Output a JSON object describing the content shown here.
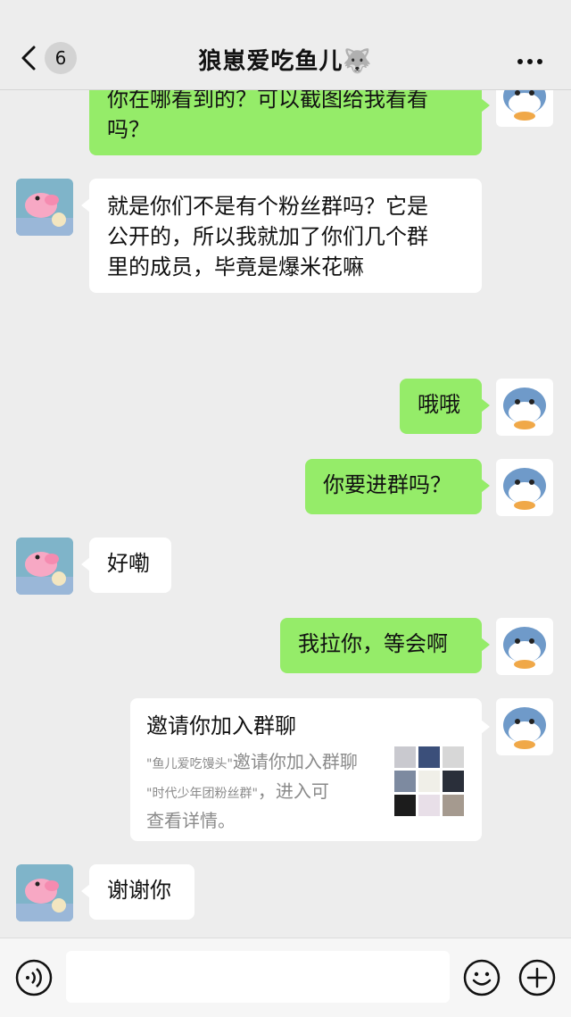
{
  "header": {
    "back_badge": "6",
    "title": "狼崽爱吃鱼儿🐺"
  },
  "messages": [
    {
      "side": "out",
      "text": "你在哪看到的？可以截图给我看看吗？",
      "lines": [
        "你在哪看到的？可以截图给我看看",
        "吗？"
      ]
    },
    {
      "side": "in",
      "text": "就是你们不是有个粉丝群吗？它是公开的，所以我就加了你们几个群里的成员，毕竟是爆米花嘛",
      "lines": [
        "就是你们不是有个粉丝群吗？它是",
        "公开的，所以我就加了你们几个群",
        "里的成员，毕竟是爆米花嘛"
      ]
    },
    {
      "side": "out",
      "text": "哦哦"
    },
    {
      "side": "out",
      "text": "你要进群吗？"
    },
    {
      "side": "in",
      "text": "好嘞"
    },
    {
      "side": "out",
      "text": "我拉你，等会啊"
    },
    {
      "side": "in",
      "text": "谢谢你"
    }
  ],
  "invite_card": {
    "title": "邀请你加入群聊",
    "inviter": "鱼儿爱吃馒头",
    "desc_line1_suffix": "邀请你加入群聊",
    "group_name": "时代少年团粉丝群",
    "desc_line2_suffix": "，进入可",
    "desc_line3": "查看详情。"
  },
  "input": {
    "placeholder": ""
  },
  "icons": {
    "back": "chevron-left-icon",
    "more": "more-dots-icon",
    "voice": "voice-icon",
    "emoji": "emoji-icon",
    "plus": "plus-icon"
  },
  "colors": {
    "outgoing_bubble": "#95ec69",
    "incoming_bubble": "#ffffff",
    "background": "#ededed"
  }
}
